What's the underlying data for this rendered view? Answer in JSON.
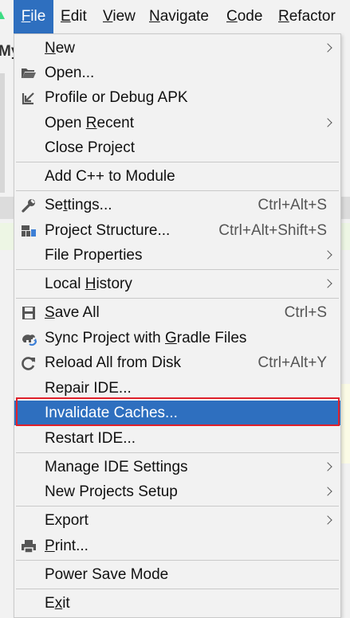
{
  "menubar": {
    "items": [
      {
        "label_pre": "",
        "mnemonic": "F",
        "label_post": "ile",
        "active": true
      },
      {
        "label_pre": "",
        "mnemonic": "E",
        "label_post": "dit",
        "active": false
      },
      {
        "label_pre": "",
        "mnemonic": "V",
        "label_post": "iew",
        "active": false
      },
      {
        "label_pre": "",
        "mnemonic": "N",
        "label_post": "avigate",
        "active": false
      },
      {
        "label_pre": "",
        "mnemonic": "C",
        "label_post": "ode",
        "active": false
      },
      {
        "label_pre": "",
        "mnemonic": "R",
        "label_post": "efactor",
        "active": false
      }
    ]
  },
  "background": {
    "left_peek_text": "My"
  },
  "file_menu": {
    "items": [
      {
        "pre": "",
        "mn": "N",
        "post": "ew",
        "shortcut": "",
        "submenu": true,
        "icon": ""
      },
      {
        "pre": "Open...",
        "mn": "",
        "post": "",
        "shortcut": "",
        "submenu": false,
        "icon": "folder-icon"
      },
      {
        "pre": "Profile or Debug APK",
        "mn": "",
        "post": "",
        "shortcut": "",
        "submenu": false,
        "icon": "import-arrow-icon"
      },
      {
        "pre": "Open ",
        "mn": "R",
        "post": "ecent",
        "shortcut": "",
        "submenu": true,
        "icon": ""
      },
      {
        "pre": "Close Project",
        "mn": "",
        "post": "",
        "shortcut": "",
        "submenu": false,
        "icon": ""
      },
      {
        "pre": "Add C++ to Module",
        "mn": "",
        "post": "",
        "shortcut": "",
        "submenu": false,
        "icon": ""
      },
      {
        "pre": "Se",
        "mn": "t",
        "post": "tings...",
        "shortcut": "Ctrl+Alt+S",
        "submenu": false,
        "icon": "wrench-icon"
      },
      {
        "pre": "Project Structure...",
        "mn": "",
        "post": "",
        "shortcut": "Ctrl+Alt+Shift+S",
        "submenu": false,
        "icon": "project-structure-icon"
      },
      {
        "pre": "File Properties",
        "mn": "",
        "post": "",
        "shortcut": "",
        "submenu": true,
        "icon": ""
      },
      {
        "pre": "Local ",
        "mn": "H",
        "post": "istory",
        "shortcut": "",
        "submenu": true,
        "icon": ""
      },
      {
        "pre": "",
        "mn": "S",
        "post": "ave All",
        "shortcut": "Ctrl+S",
        "submenu": false,
        "icon": "save-icon"
      },
      {
        "pre": "Sync Project with ",
        "mn": "G",
        "post": "radle Files",
        "shortcut": "",
        "submenu": false,
        "icon": "gradle-sync-icon"
      },
      {
        "pre": "Reload All from Disk",
        "mn": "",
        "post": "",
        "shortcut": "Ctrl+Alt+Y",
        "submenu": false,
        "icon": "reload-icon"
      },
      {
        "pre": "Repair IDE...",
        "mn": "",
        "post": "",
        "shortcut": "",
        "submenu": false,
        "icon": ""
      },
      {
        "pre": "Invalidate Caches...",
        "mn": "",
        "post": "",
        "shortcut": "",
        "submenu": false,
        "icon": ""
      },
      {
        "pre": "Restart IDE...",
        "mn": "",
        "post": "",
        "shortcut": "",
        "submenu": false,
        "icon": ""
      },
      {
        "pre": "Manage IDE Settings",
        "mn": "",
        "post": "",
        "shortcut": "",
        "submenu": true,
        "icon": ""
      },
      {
        "pre": "New Projects Setup",
        "mn": "",
        "post": "",
        "shortcut": "",
        "submenu": true,
        "icon": ""
      },
      {
        "pre": "Export",
        "mn": "",
        "post": "",
        "shortcut": "",
        "submenu": true,
        "icon": ""
      },
      {
        "pre": "",
        "mn": "P",
        "post": "rint...",
        "shortcut": "",
        "submenu": false,
        "icon": "printer-icon"
      },
      {
        "pre": "Power Save Mode",
        "mn": "",
        "post": "",
        "shortcut": "",
        "submenu": false,
        "icon": ""
      },
      {
        "pre": "E",
        "mn": "x",
        "post": "it",
        "shortcut": "",
        "submenu": false,
        "icon": ""
      }
    ],
    "selected_label": "Invalidate Caches..."
  },
  "colors": {
    "accent": "#2e6fbf",
    "highlight_border": "#e0202a",
    "menu_bg": "#f2f2f2"
  }
}
